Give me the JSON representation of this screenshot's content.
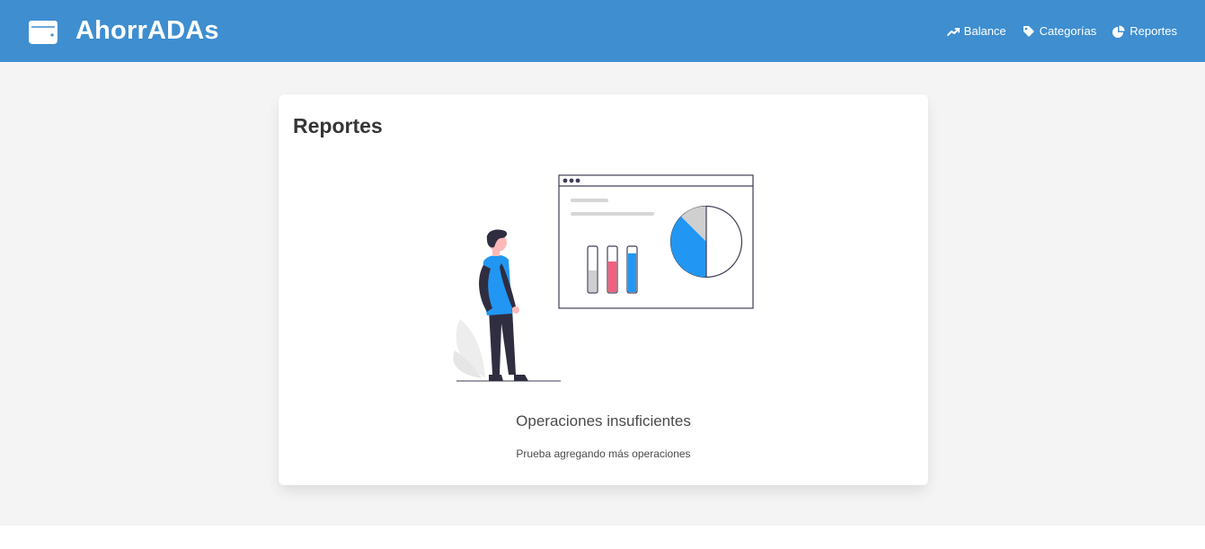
{
  "navbar": {
    "brand_icon": "wallet-icon",
    "brand_title": "AhorrADAs",
    "background": "#3e8ed0",
    "items": [
      {
        "label": "Balance",
        "icon": "trend-up-icon"
      },
      {
        "label": "Categorías",
        "icon": "tag-icon"
      },
      {
        "label": "Reportes",
        "icon": "pie-chart-icon"
      }
    ]
  },
  "card": {
    "title": "Reportes",
    "illustration": "person-looking-at-report-dashboard",
    "empty_title": "Operaciones insuficientes",
    "empty_subtitle": "Prueba agregando más operaciones"
  },
  "colors": {
    "accent_blue": "#2197f3",
    "accent_pink": "#f55f7e",
    "page_background": "#f4f4f4"
  }
}
